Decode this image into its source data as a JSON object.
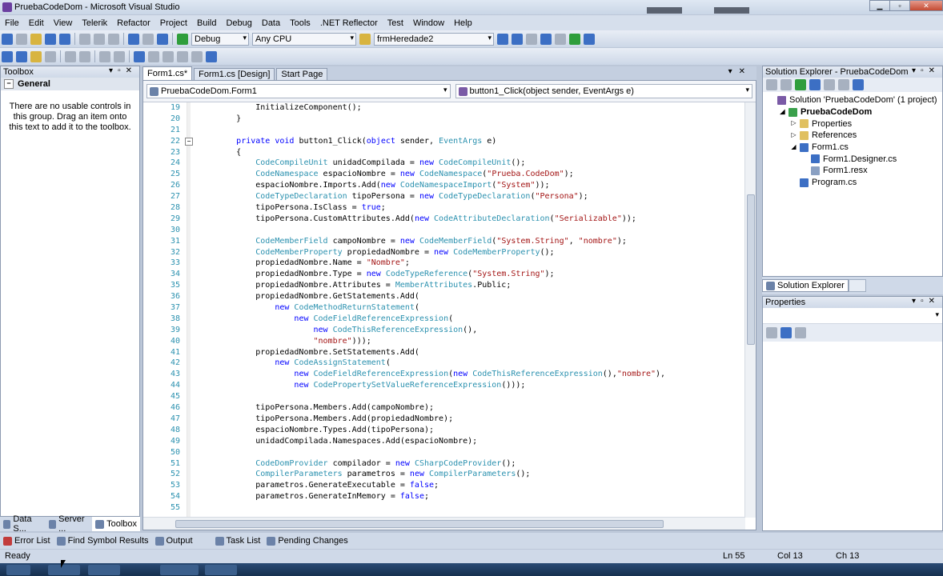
{
  "window": {
    "title": "PruebaCodeDom - Microsoft Visual Studio"
  },
  "menu": [
    "File",
    "Edit",
    "View",
    "Telerik",
    "Refactor",
    "Project",
    "Build",
    "Debug",
    "Data",
    "Tools",
    ".NET Reflector",
    "Test",
    "Window",
    "Help"
  ],
  "toolbar": {
    "config": "Debug",
    "platform": "Any CPU",
    "find": "frmHeredade2"
  },
  "toolbox": {
    "title": "Toolbox",
    "group": "General",
    "message": "There are no usable controls in this group. Drag an item onto this text to add it to the toolbox.",
    "tabs": [
      "Data S...",
      "Server ...",
      "Toolbox"
    ]
  },
  "editor": {
    "tabs": [
      "Form1.cs*",
      "Form1.cs [Design]",
      "Start Page"
    ],
    "class_combo": "PruebaCodeDom.Form1",
    "member_combo": "button1_Click(object sender, EventArgs e)",
    "lines": [
      {
        "n": "19",
        "t": "            InitializeComponent();"
      },
      {
        "n": "20",
        "t": "        }"
      },
      {
        "n": "21",
        "t": ""
      },
      {
        "n": "22",
        "t": "        private void button1_Click(object sender, EventArgs e)"
      },
      {
        "n": "23",
        "t": "        {"
      },
      {
        "n": "24",
        "t": "            CodeCompileUnit unidadCompilada = new CodeCompileUnit();"
      },
      {
        "n": "25",
        "t": "            CodeNamespace espacioNombre = new CodeNamespace(\"Prueba.CodeDom\");"
      },
      {
        "n": "26",
        "t": "            espacioNombre.Imports.Add(new CodeNamespaceImport(\"System\"));"
      },
      {
        "n": "27",
        "t": "            CodeTypeDeclaration tipoPersona = new CodeTypeDeclaration(\"Persona\");"
      },
      {
        "n": "28",
        "t": "            tipoPersona.IsClass = true;"
      },
      {
        "n": "29",
        "t": "            tipoPersona.CustomAttributes.Add(new CodeAttributeDeclaration(\"Serializable\"));"
      },
      {
        "n": "30",
        "t": ""
      },
      {
        "n": "31",
        "t": "            CodeMemberField campoNombre = new CodeMemberField(\"System.String\", \"nombre\");"
      },
      {
        "n": "32",
        "t": "            CodeMemberProperty propiedadNombre = new CodeMemberProperty();"
      },
      {
        "n": "33",
        "t": "            propiedadNombre.Name = \"Nombre\";"
      },
      {
        "n": "34",
        "t": "            propiedadNombre.Type = new CodeTypeReference(\"System.String\");"
      },
      {
        "n": "35",
        "t": "            propiedadNombre.Attributes = MemberAttributes.Public;"
      },
      {
        "n": "36",
        "t": "            propiedadNombre.GetStatements.Add("
      },
      {
        "n": "37",
        "t": "                new CodeMethodReturnStatement("
      },
      {
        "n": "38",
        "t": "                    new CodeFieldReferenceExpression("
      },
      {
        "n": "39",
        "t": "                        new CodeThisReferenceExpression(),"
      },
      {
        "n": "40",
        "t": "                        \"nombre\")));"
      },
      {
        "n": "41",
        "t": "            propiedadNombre.SetStatements.Add("
      },
      {
        "n": "42",
        "t": "                new CodeAssignStatement("
      },
      {
        "n": "43",
        "t": "                    new CodeFieldReferenceExpression(new CodeThisReferenceExpression(),\"nombre\"),"
      },
      {
        "n": "44",
        "t": "                    new CodePropertySetValueReferenceExpression()));"
      },
      {
        "n": "45",
        "t": ""
      },
      {
        "n": "46",
        "t": "            tipoPersona.Members.Add(campoNombre);"
      },
      {
        "n": "47",
        "t": "            tipoPersona.Members.Add(propiedadNombre);"
      },
      {
        "n": "48",
        "t": "            espacioNombre.Types.Add(tipoPersona);"
      },
      {
        "n": "49",
        "t": "            unidadCompilada.Namespaces.Add(espacioNombre);"
      },
      {
        "n": "50",
        "t": ""
      },
      {
        "n": "51",
        "t": "            CodeDomProvider compilador = new CSharpCodeProvider();"
      },
      {
        "n": "52",
        "t": "            CompilerParameters parametros = new CompilerParameters();"
      },
      {
        "n": "53",
        "t": "            parametros.GenerateExecutable = false;"
      },
      {
        "n": "54",
        "t": "            parametros.GenerateInMemory = false;"
      },
      {
        "n": "55",
        "t": ""
      }
    ]
  },
  "solution_explorer": {
    "title": "Solution Explorer - PruebaCodeDom",
    "nodes": [
      {
        "label": "Solution 'PruebaCodeDom' (1 project)",
        "indent": 0,
        "icon": "sol"
      },
      {
        "label": "PruebaCodeDom",
        "indent": 1,
        "icon": "proj",
        "bold": true
      },
      {
        "label": "Properties",
        "indent": 2,
        "icon": "fld"
      },
      {
        "label": "References",
        "indent": 2,
        "icon": "fld"
      },
      {
        "label": "Form1.cs",
        "indent": 2,
        "icon": "cs"
      },
      {
        "label": "Form1.Designer.cs",
        "indent": 3,
        "icon": "cs"
      },
      {
        "label": "Form1.resx",
        "indent": 3,
        "icon": "gr"
      },
      {
        "label": "Program.cs",
        "indent": 2,
        "icon": "cs"
      }
    ],
    "tab": "Solution Explorer"
  },
  "properties": {
    "title": "Properties"
  },
  "bottom_tabs": [
    "Error List",
    "Find Symbol Results",
    "Output",
    "Task List",
    "Pending Changes"
  ],
  "status": {
    "text": "Ready",
    "line": "Ln 55",
    "col": "Col 13",
    "ch": "Ch 13"
  },
  "colors": {
    "keyword": "#0000ff",
    "type": "#2b91af",
    "string": "#a31515",
    "linenum": "#2b91af"
  }
}
